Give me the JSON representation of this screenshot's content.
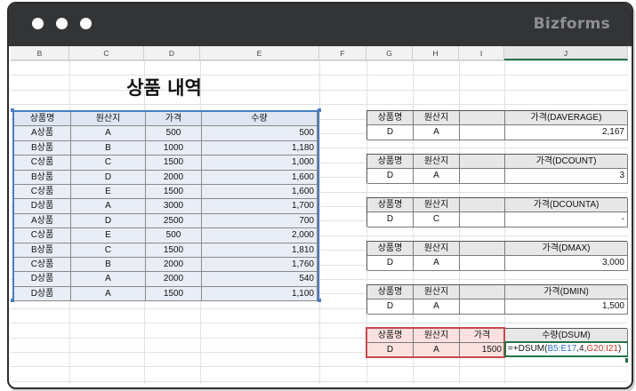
{
  "brand": "Bizforms",
  "columns": [
    "B",
    "C",
    "D",
    "E",
    "F",
    "G",
    "H",
    "I",
    "J"
  ],
  "selected_column": "J",
  "title": "상품 내역",
  "main_table": {
    "headers": [
      "상품명",
      "원산지",
      "가격",
      "수량"
    ],
    "rows": [
      [
        "A상품",
        "A",
        "500",
        "500"
      ],
      [
        "B상품",
        "B",
        "1000",
        "1,180"
      ],
      [
        "C상품",
        "C",
        "1500",
        "1,000"
      ],
      [
        "B상품",
        "D",
        "2000",
        "1,600"
      ],
      [
        "C상품",
        "E",
        "1500",
        "1,600"
      ],
      [
        "D상품",
        "A",
        "3000",
        "1,700"
      ],
      [
        "A상품",
        "D",
        "2500",
        "700"
      ],
      [
        "C상품",
        "E",
        "500",
        "2,000"
      ],
      [
        "B상품",
        "C",
        "1500",
        "1,810"
      ],
      [
        "C상품",
        "B",
        "2000",
        "1,760"
      ],
      [
        "D상품",
        "A",
        "2000",
        "540"
      ],
      [
        "D상품",
        "A",
        "1500",
        "1,100"
      ]
    ]
  },
  "criteria_tables": [
    {
      "h1": "상품명",
      "h2": "원산지",
      "h3": "",
      "h4": "가격(DAVERAGE)",
      "v1": "D",
      "v2": "A",
      "v3": "",
      "v4": "2,167"
    },
    {
      "h1": "상품명",
      "h2": "원산지",
      "h3": "",
      "h4": "가격(DCOUNT)",
      "v1": "D",
      "v2": "A",
      "v3": "",
      "v4": "3"
    },
    {
      "h1": "상품명",
      "h2": "원산지",
      "h3": "",
      "h4": "가격(DCOUNTA)",
      "v1": "D",
      "v2": "C",
      "v3": "",
      "v4": "-"
    },
    {
      "h1": "상품명",
      "h2": "원산지",
      "h3": "",
      "h4": "가격(DMAX)",
      "v1": "D",
      "v2": "A",
      "v3": "",
      "v4": "3,000"
    },
    {
      "h1": "상품명",
      "h2": "원산지",
      "h3": "",
      "h4": "가격(DMIN)",
      "v1": "D",
      "v2": "A",
      "v3": "",
      "v4": "1,500"
    }
  ],
  "dsum_table": {
    "h1": "상품명",
    "h2": "원산지",
    "h3": "가격",
    "h4": "수량(DSUM)",
    "v1": "D",
    "v2": "A",
    "v3": "1500",
    "formula": {
      "prefix": "=+DSUM(",
      "ref1": "B5:E17",
      "mid": ",4,",
      "ref2": "G20:I21",
      "suffix": ")"
    }
  },
  "colors": {
    "titlebar": "#333436",
    "selection_blue": "#4a7cc0",
    "dsum_red": "#c8484d",
    "excel_green": "#217346"
  }
}
